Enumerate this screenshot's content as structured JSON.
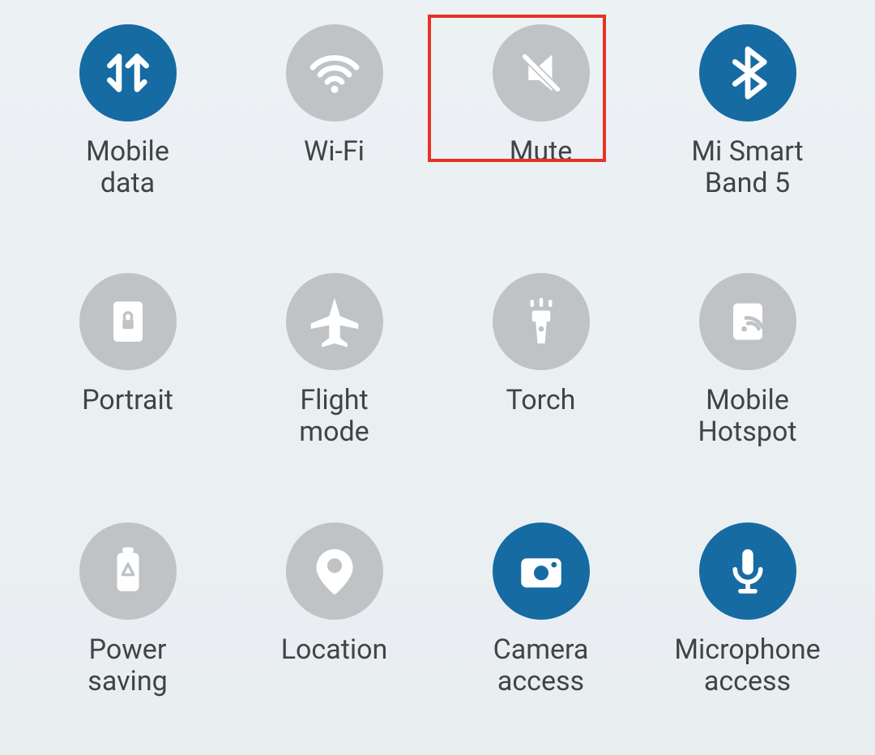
{
  "colors": {
    "active": "#166ba3",
    "inactive": "#bfc3c6",
    "highlight": "#e73323"
  },
  "tiles": [
    {
      "id": "mobile-data",
      "label": "Mobile\ndata",
      "active": true,
      "highlighted": false,
      "icon": "data-arrows-icon"
    },
    {
      "id": "wifi",
      "label": "Wi-Fi",
      "active": false,
      "highlighted": false,
      "icon": "wifi-icon"
    },
    {
      "id": "mute",
      "label": "Mute",
      "active": false,
      "highlighted": true,
      "icon": "mute-icon"
    },
    {
      "id": "bluetooth-band",
      "label": "Mi Smart\nBand 5",
      "active": true,
      "highlighted": false,
      "icon": "bluetooth-icon"
    },
    {
      "id": "portrait",
      "label": "Portrait",
      "active": false,
      "highlighted": false,
      "icon": "portrait-lock-icon"
    },
    {
      "id": "flight-mode",
      "label": "Flight\nmode",
      "active": false,
      "highlighted": false,
      "icon": "airplane-icon"
    },
    {
      "id": "torch",
      "label": "Torch",
      "active": false,
      "highlighted": false,
      "icon": "torch-icon"
    },
    {
      "id": "mobile-hotspot",
      "label": "Mobile\nHotspot",
      "active": false,
      "highlighted": false,
      "icon": "hotspot-icon"
    },
    {
      "id": "power-saving",
      "label": "Power\nsaving",
      "active": false,
      "highlighted": false,
      "icon": "battery-icon"
    },
    {
      "id": "location",
      "label": "Location",
      "active": false,
      "highlighted": false,
      "icon": "location-pin-icon"
    },
    {
      "id": "camera-access",
      "label": "Camera\naccess",
      "active": true,
      "highlighted": false,
      "icon": "camera-icon"
    },
    {
      "id": "microphone-access",
      "label": "Microphone\naccess",
      "active": true,
      "highlighted": false,
      "icon": "microphone-icon"
    }
  ]
}
